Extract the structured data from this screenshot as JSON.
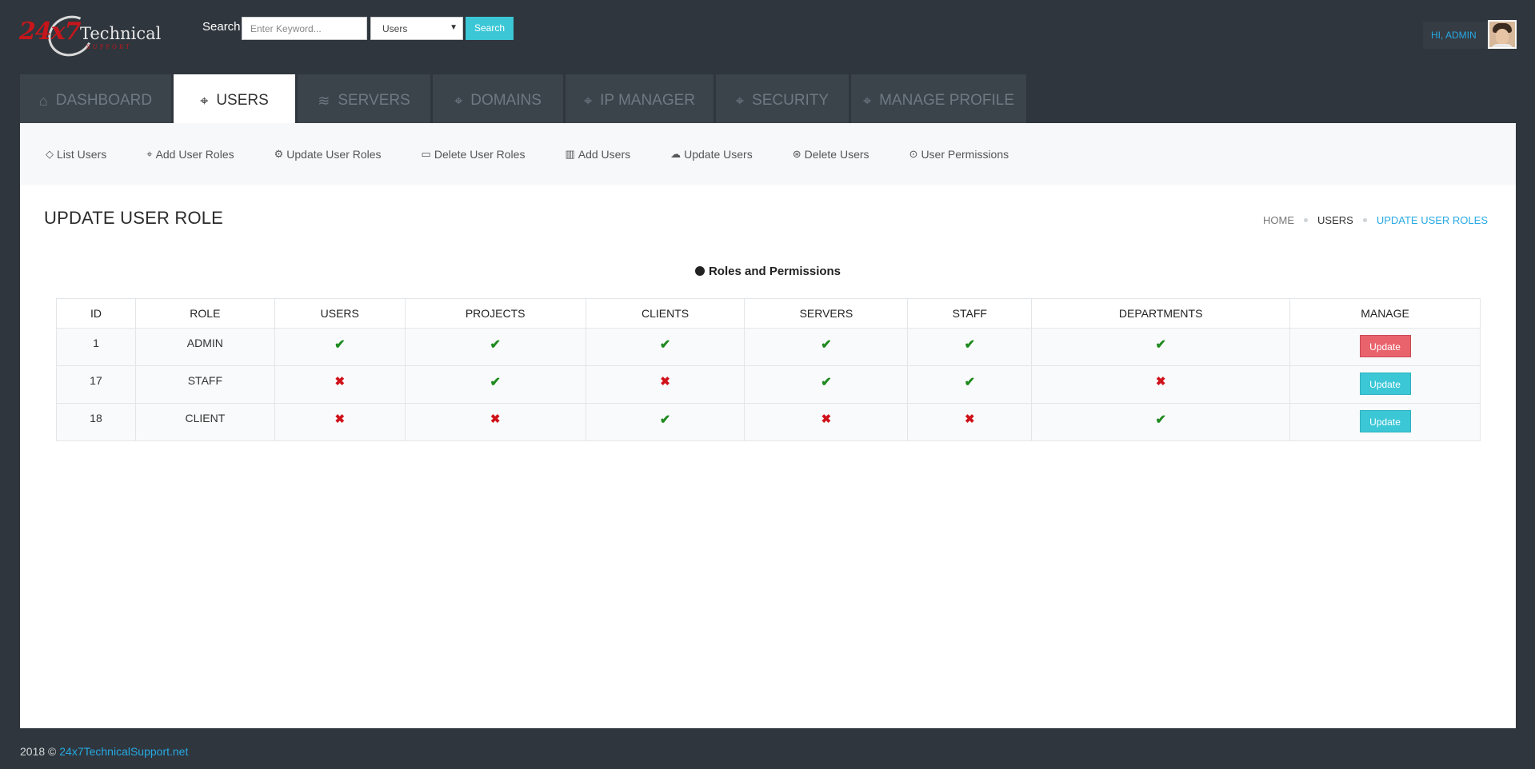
{
  "header": {
    "logo": {
      "num": "24x7",
      "word": "Technical",
      "sub": "SUPPORT"
    },
    "search_label": "Search",
    "search_placeholder": "Enter Keyword...",
    "search_select": "Users",
    "search_button": "Search",
    "greeting": "HI, ADMIN"
  },
  "tabs": [
    {
      "label": "DASHBOARD",
      "icon": "home-icon",
      "glyph": "⌂"
    },
    {
      "label": "USERS",
      "icon": "tag-icon",
      "glyph": "⌖"
    },
    {
      "label": "SERVERS",
      "icon": "layers-icon",
      "glyph": "≋"
    },
    {
      "label": "DOMAINS",
      "icon": "tag-icon",
      "glyph": "⌖"
    },
    {
      "label": "IP MANAGER",
      "icon": "tag-icon",
      "glyph": "⌖"
    },
    {
      "label": "SECURITY",
      "icon": "tag-icon",
      "glyph": "⌖"
    },
    {
      "label": "MANAGE PROFILE",
      "icon": "tag-icon",
      "glyph": "⌖"
    }
  ],
  "subnav": [
    {
      "label": "List Users",
      "icon": "diamond-icon",
      "glyph": "◇"
    },
    {
      "label": "Add User Roles",
      "icon": "tag-icon",
      "glyph": "⌖"
    },
    {
      "label": "Update User Roles",
      "icon": "gear-icon",
      "glyph": "⚙"
    },
    {
      "label": "Delete User Roles",
      "icon": "folder-icon",
      "glyph": "▭"
    },
    {
      "label": "Add Users",
      "icon": "bar-chart-icon",
      "glyph": "▥"
    },
    {
      "label": "Update Users",
      "icon": "cloud-upload-icon",
      "glyph": "☁"
    },
    {
      "label": "Delete Users",
      "icon": "dribbble-icon",
      "glyph": "⊛"
    },
    {
      "label": "User Permissions",
      "icon": "location-pin-icon",
      "glyph": "⊙"
    }
  ],
  "page": {
    "title": "UPDATE USER ROLE",
    "breadcrumb": [
      "HOME",
      "USERS",
      "UPDATE USER ROLES"
    ],
    "table_title": "Roles and Permissions"
  },
  "table": {
    "columns": [
      "ID",
      "ROLE",
      "USERS",
      "PROJECTS",
      "CLIENTS",
      "SERVERS",
      "STAFF",
      "DEPARTMENTS",
      "MANAGE"
    ],
    "rows": [
      {
        "id": "1",
        "role": "ADMIN",
        "perms": [
          true,
          true,
          true,
          true,
          true,
          true
        ],
        "button": "Update",
        "button_color": "#e9636d"
      },
      {
        "id": "17",
        "role": "STAFF",
        "perms": [
          false,
          true,
          false,
          true,
          true,
          false
        ],
        "button": "Update",
        "button_color": "#3bc7d6"
      },
      {
        "id": "18",
        "role": "CLIENT",
        "perms": [
          false,
          false,
          true,
          false,
          false,
          true
        ],
        "button": "Update",
        "button_color": "#3bc7d6"
      }
    ]
  },
  "footer": {
    "copyright": "2018 ©",
    "link": "24x7TechnicalSupport.net"
  },
  "colors": {
    "accent": "#3bc7d6",
    "link": "#27a9e3",
    "danger": "#e9636d",
    "yes": "#1e8a1e",
    "no": "#d0121a"
  }
}
